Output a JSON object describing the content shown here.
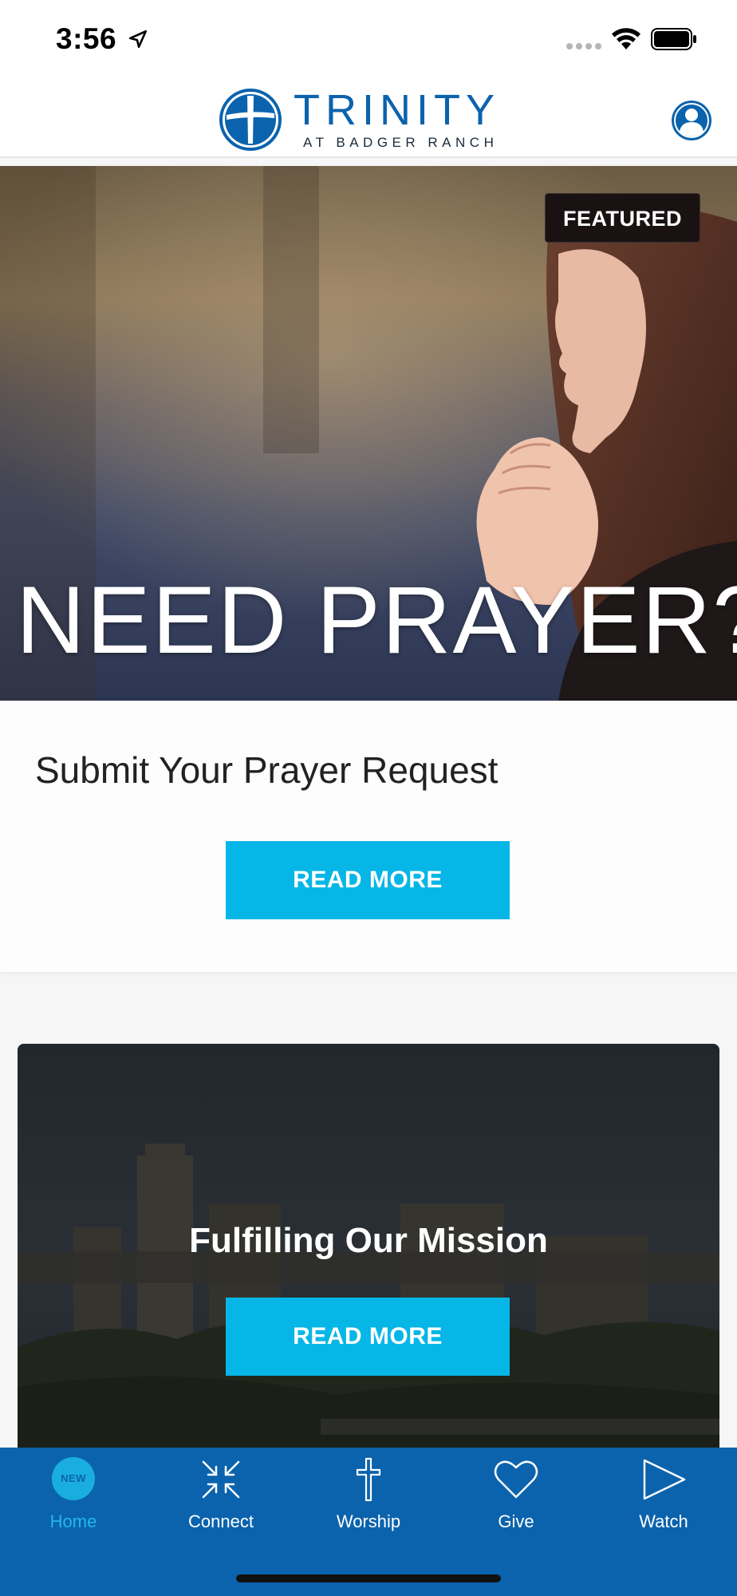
{
  "status_bar": {
    "time": "3:56"
  },
  "header": {
    "logo_main": "TRINITY",
    "logo_sub": "AT BADGER RANCH",
    "brand_color": "#0b63ad"
  },
  "featured": {
    "badge": "FEATURED",
    "image_text": "NEED PRAYER?",
    "title": "Submit Your Prayer Request",
    "button": "READ MORE"
  },
  "mission": {
    "title": "Fulfilling Our Mission",
    "button": "READ MORE"
  },
  "tabs": [
    {
      "label": "Home",
      "icon": "home-new-badge-icon",
      "badge": "NEW",
      "active": true
    },
    {
      "label": "Connect",
      "icon": "connect-arrows-icon",
      "active": false
    },
    {
      "label": "Worship",
      "icon": "cross-icon",
      "active": false
    },
    {
      "label": "Give",
      "icon": "heart-icon",
      "active": false
    },
    {
      "label": "Watch",
      "icon": "play-icon",
      "active": false
    }
  ],
  "colors": {
    "accent": "#06b6e6",
    "tab_bar": "#0b63ad",
    "active_tab": "#23b6ea"
  }
}
